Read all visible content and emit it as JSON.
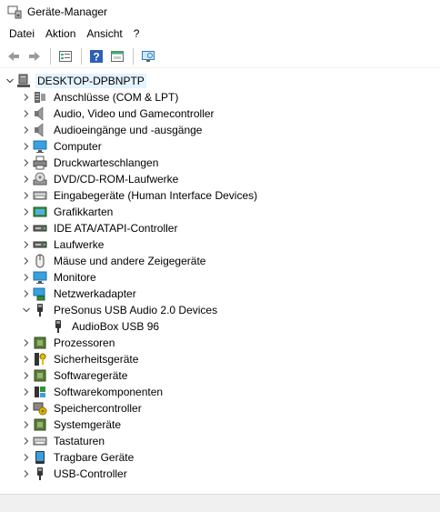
{
  "window": {
    "title": "Geräte-Manager"
  },
  "menu": [
    "Datei",
    "Aktion",
    "Ansicht",
    "?"
  ],
  "toolbar": {
    "buttons": [
      "back-arrow-icon",
      "forward-arrow-icon",
      "properties-icon",
      "help-icon",
      "driver-update-icon",
      "scan-hardware-icon"
    ]
  },
  "tree": {
    "root": "DESKTOP-DPBNPTP",
    "categories": [
      {
        "label": "Anschlüsse (COM & LPT)",
        "icon": "port-icon"
      },
      {
        "label": "Audio, Video und Gamecontroller",
        "icon": "speaker-icon"
      },
      {
        "label": "Audioeingänge und -ausgänge",
        "icon": "speaker-icon"
      },
      {
        "label": "Computer",
        "icon": "monitor-icon"
      },
      {
        "label": "Druckwarteschlangen",
        "icon": "printer-icon"
      },
      {
        "label": "DVD/CD-ROM-Laufwerke",
        "icon": "disc-drive-icon"
      },
      {
        "label": "Eingabegeräte (Human Interface Devices)",
        "icon": "keyboard-icon"
      },
      {
        "label": "Grafikkarten",
        "icon": "graphics-card-icon"
      },
      {
        "label": "IDE ATA/ATAPI-Controller",
        "icon": "drive-icon"
      },
      {
        "label": "Laufwerke",
        "icon": "drive-icon"
      },
      {
        "label": "Mäuse und andere Zeigegeräte",
        "icon": "mouse-icon"
      },
      {
        "label": "Monitore",
        "icon": "monitor-icon"
      },
      {
        "label": "Netzwerkadapter",
        "icon": "network-icon"
      },
      {
        "label": "PreSonus USB Audio 2.0 Devices",
        "icon": "usb-icon",
        "expanded": true,
        "children": [
          "AudioBox USB 96"
        ]
      },
      {
        "label": "Prozessoren",
        "icon": "chip-icon"
      },
      {
        "label": "Sicherheitsgeräte",
        "icon": "key-icon"
      },
      {
        "label": "Softwaregeräte",
        "icon": "chip-icon"
      },
      {
        "label": "Softwarekomponenten",
        "icon": "puzzle-icon"
      },
      {
        "label": "Speichercontroller",
        "icon": "storage-controller-icon"
      },
      {
        "label": "Systemgeräte",
        "icon": "chip-icon"
      },
      {
        "label": "Tastaturen",
        "icon": "keyboard-icon"
      },
      {
        "label": "Tragbare Geräte",
        "icon": "portable-device-icon"
      },
      {
        "label": "USB-Controller",
        "icon": "usb-icon"
      }
    ]
  }
}
